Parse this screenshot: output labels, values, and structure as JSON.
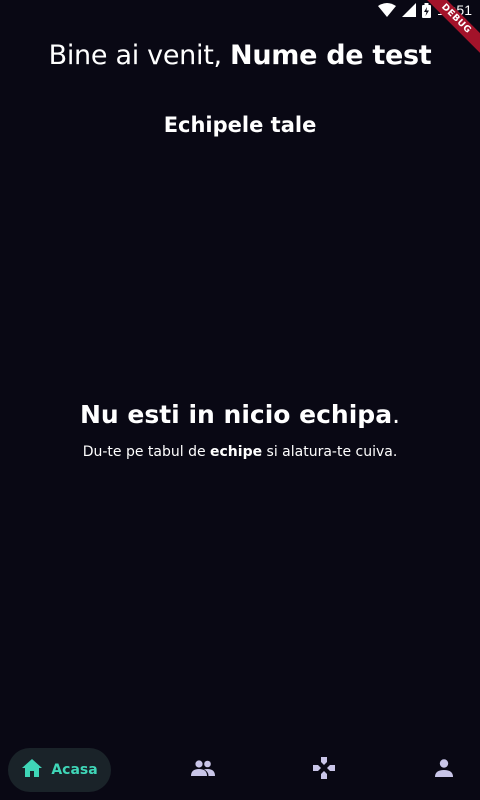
{
  "status_bar": {
    "time": "18:51",
    "debug_label": "DEBUG"
  },
  "header": {
    "greeting": "Bine ai venit, ",
    "user_name": "Nume de test"
  },
  "teams_section": {
    "title": "Echipele tale"
  },
  "empty_state": {
    "title_bold": "Nu esti in nicio echipa",
    "title_suffix": ".",
    "sub_before": "Du-te pe tabul de ",
    "sub_bold": "echipe",
    "sub_after": " si alatura-te cuiva."
  },
  "bottom_nav": {
    "items": [
      {
        "label": "Acasa",
        "icon": "home-icon",
        "active": true
      },
      {
        "label": "",
        "icon": "people-icon",
        "active": false
      },
      {
        "label": "",
        "icon": "gamepad-icon",
        "active": false
      },
      {
        "label": "",
        "icon": "person-icon",
        "active": false
      }
    ]
  },
  "colors": {
    "background": "#090814",
    "accent": "#3fd6b7",
    "nav_active_bg": "#1a2329",
    "nav_icon": "#c9c5e8",
    "debug_ribbon": "#a3132a"
  }
}
